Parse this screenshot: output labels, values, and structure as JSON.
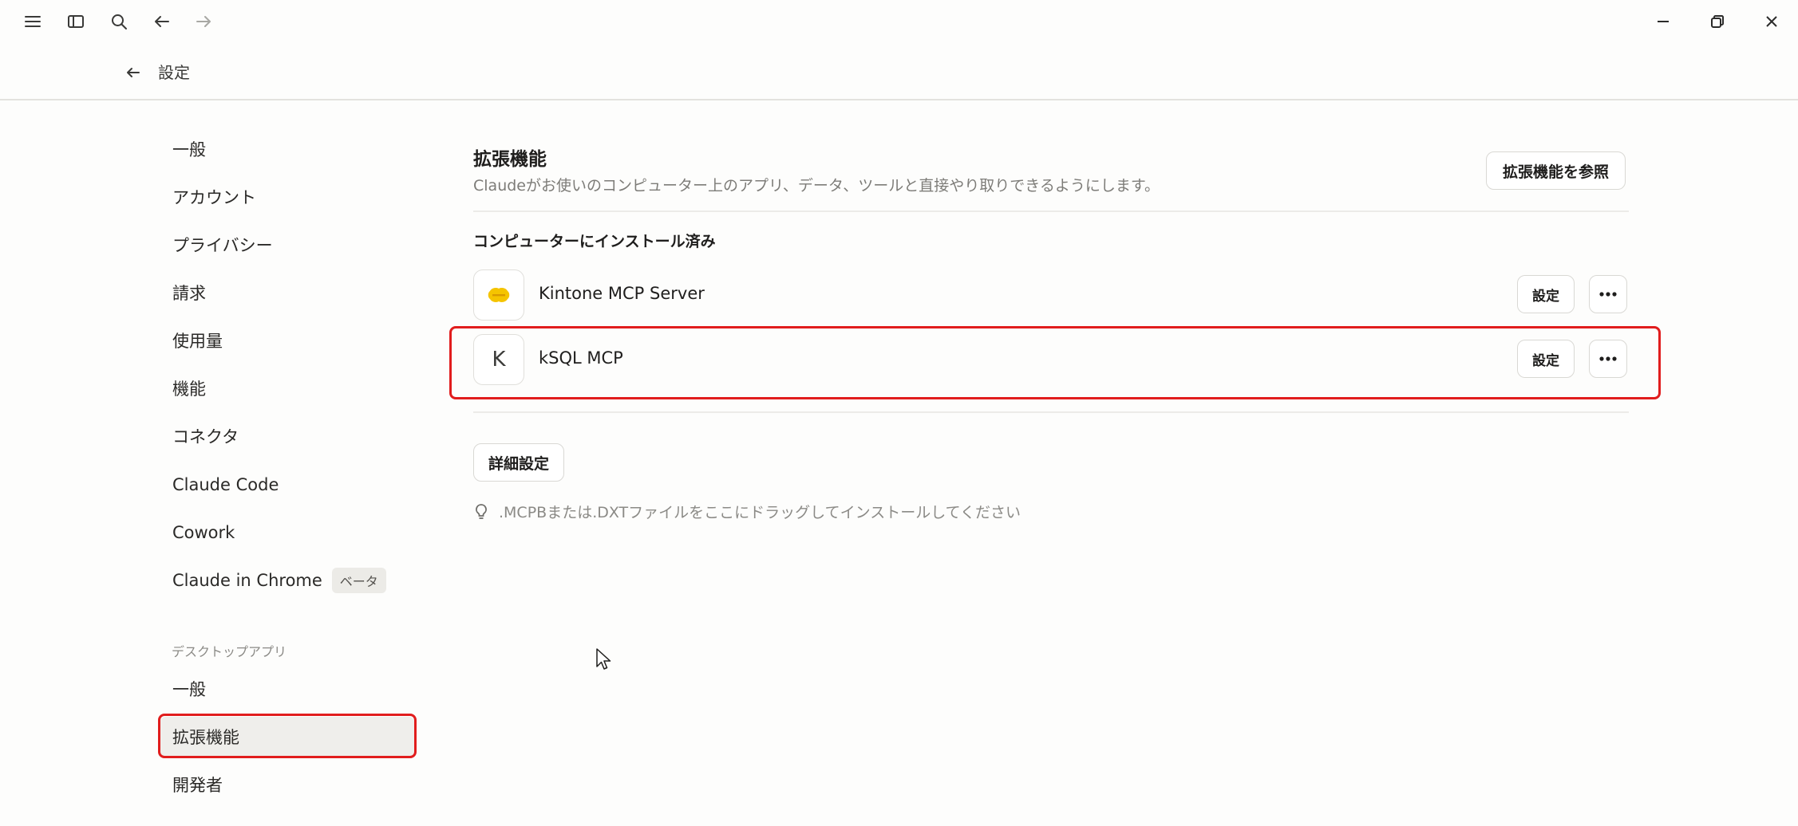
{
  "header": {
    "title": "設定"
  },
  "sidebar": {
    "items": [
      {
        "label": "一般"
      },
      {
        "label": "アカウント"
      },
      {
        "label": "プライバシー"
      },
      {
        "label": "請求"
      },
      {
        "label": "使用量"
      },
      {
        "label": "機能"
      },
      {
        "label": "コネクタ"
      },
      {
        "label": "Claude Code"
      },
      {
        "label": "Cowork"
      },
      {
        "label": "Claude in Chrome",
        "badge": "ベータ"
      }
    ],
    "desktop_section_label": "デスクトップアプリ",
    "desktop_items": [
      {
        "label": "一般"
      },
      {
        "label": "拡張機能",
        "active": true
      },
      {
        "label": "開発者"
      }
    ]
  },
  "main": {
    "title": "拡張機能",
    "description": "Claudeがお使いのコンピューター上のアプリ、データ、ツールと直接やり取りできるようにします。",
    "browse_label": "拡張機能を参照",
    "installed_label": "コンピューターにインストール済み",
    "extensions": [
      {
        "name": "Kintone MCP Server",
        "icon": "kintone-logo-icon",
        "settings_label": "設定"
      },
      {
        "name": "kSQL MCP",
        "icon_letter": "K",
        "settings_label": "設定"
      }
    ],
    "advanced_label": "詳細設定",
    "hint": ".MCPBまたは.DXTファイルをここにドラッグしてインストールしてください"
  },
  "colors": {
    "highlight": "#e11d1d",
    "kintone_yellow": "#f5c400"
  }
}
